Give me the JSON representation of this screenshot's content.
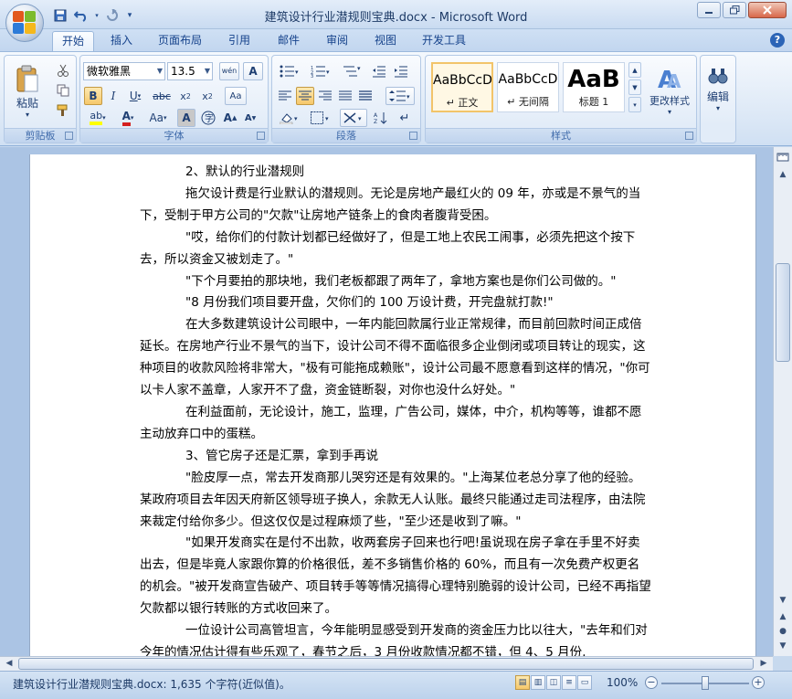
{
  "window": {
    "title": "建筑设计行业潜规则宝典.docx - Microsoft Word"
  },
  "quick_access": {
    "save_icon": "save-icon",
    "undo_icon": "undo-icon",
    "redo_icon": "redo-icon"
  },
  "tabs": [
    "开始",
    "插入",
    "页面布局",
    "引用",
    "邮件",
    "审阅",
    "视图",
    "开发工具"
  ],
  "ribbon": {
    "clipboard": {
      "label": "剪贴板",
      "paste": "粘贴"
    },
    "font": {
      "label": "字体",
      "font_name": "微软雅黑",
      "font_size": "13.5",
      "wen_btn": "wén",
      "font_color": "#d41f1f",
      "highlight_color": "#ffff00"
    },
    "paragraph": {
      "label": "段落"
    },
    "styles": {
      "label": "样式",
      "items": [
        {
          "sample": "AaBbCcD",
          "name": "↵ 正文"
        },
        {
          "sample": "AaBbCcD",
          "name": "↵ 无间隔"
        },
        {
          "sample": "AaB",
          "name": "标题 1"
        }
      ],
      "change_styles": "更改样式"
    },
    "editing": {
      "label": "编辑"
    }
  },
  "document": {
    "paragraphs": [
      {
        "text": "2、默认的行业潜规则",
        "indent": true
      },
      {
        "text": "拖欠设计费是行业默认的潜规则。无论是房地产最红火的 09 年，亦或是不景气的当下，受制于甲方公司的\"欠款\"让房地产链条上的食肉者腹背受困。",
        "indent": true
      },
      {
        "text": "\"哎，给你们的付款计划都已经做好了，但是工地上农民工闹事，必须先把这个按下去，所以资金又被划走了。\"",
        "indent": true
      },
      {
        "text": "\"下个月要拍的那块地，我们老板都跟了两年了，拿地方案也是你们公司做的。\"",
        "indent": true
      },
      {
        "text": "\"8 月份我们项目要开盘，欠你们的 100 万设计费，开完盘就打款!\"",
        "indent": true
      },
      {
        "text": "在大多数建筑设计公司眼中，一年内能回款属行业正常规律，而目前回款时间正成倍延长。在房地产行业不景气的当下，设计公司不得不面临很多企业倒闭或项目转让的现实，这种项目的收款风险将非常大，\"极有可能拖成赖账\"，设计公司最不愿意看到这样的情况，\"你可以卡人家不盖章，人家开不了盘，资金链断裂，对你也没什么好处。\"",
        "indent": true
      },
      {
        "text": "在利益面前，无论设计，施工，监理，广告公司，媒体，中介，机构等等，谁都不愿主动放弃口中的蛋糕。",
        "indent": true
      },
      {
        "text": "3、管它房子还是汇票，拿到手再说",
        "indent": true
      },
      {
        "text": "\"脸皮厚一点，常去开发商那儿哭穷还是有效果的。\"上海某位老总分享了他的经验。某政府项目去年因天府新区领导班子换人，余款无人认账。最终只能通过走司法程序，由法院来裁定付给你多少。但这仅仅是过程麻烦了些，\"至少还是收到了嘛。\"",
        "indent": true
      },
      {
        "text": "\"如果开发商实在是付不出款，收两套房子回来也行吧!虽说现在房子拿在手里不好卖出去，但是毕竟人家跟你算的价格很低，差不多销售价格的 60%，而且有一次免费产权更名的机会。\"被开发商宣告破产、项目转手等等情况搞得心理特别脆弱的设计公司，已经不再指望欠款都以银行转账的方式收回来了。",
        "indent": true
      },
      {
        "text": "一位设计公司高管坦言，今年能明显感受到开发商的资金压力比以往大，\"去年和们对今年的情况估计得有些乐观了，春节之后，3 月份收款情况都不错，但 4、5 月份,",
        "indent": true
      }
    ]
  },
  "status": {
    "text": "建筑设计行业潜规则宝典.docx: 1,635 个字符(近似值)。",
    "zoom": "100%"
  }
}
